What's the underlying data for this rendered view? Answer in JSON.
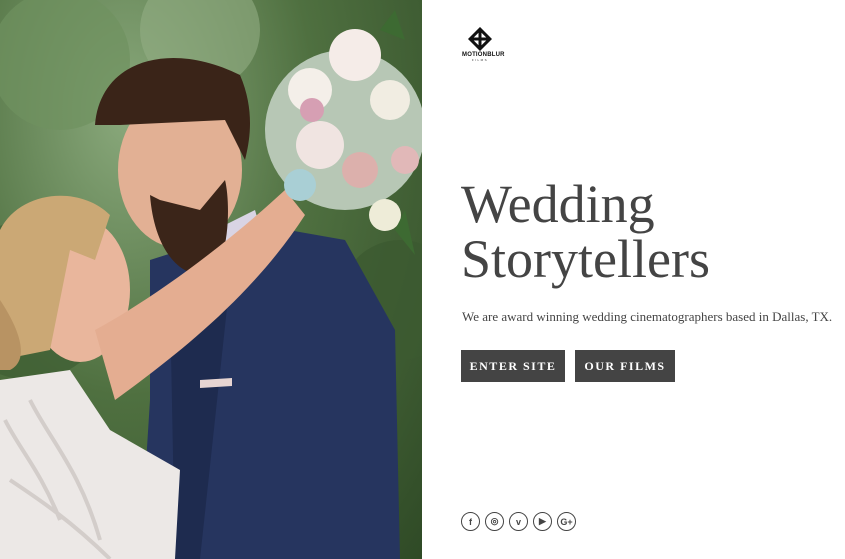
{
  "brand": {
    "name": "MOTIONBLUR",
    "sub": "FILMS",
    "logo_icon": "knot-logo-icon"
  },
  "hero": {
    "title_line1": "Wedding",
    "title_line2": "Storytellers",
    "tagline": "We are award winning wedding cinematographers based in Dallas, TX.",
    "image": "wedding-couple-photo"
  },
  "buttons": {
    "enter": "ENTER SITE",
    "films": "OUR FILMS"
  },
  "social": [
    {
      "icon": "facebook-icon",
      "glyph": "f"
    },
    {
      "icon": "instagram-icon",
      "glyph": "◎"
    },
    {
      "icon": "vimeo-icon",
      "glyph": "v"
    },
    {
      "icon": "youtube-icon",
      "glyph": "▶"
    },
    {
      "icon": "google-plus-icon",
      "glyph": "G+"
    }
  ],
  "colors": {
    "text": "#444444",
    "button_bg": "#444444",
    "button_text": "#ffffff",
    "background": "#ffffff"
  }
}
